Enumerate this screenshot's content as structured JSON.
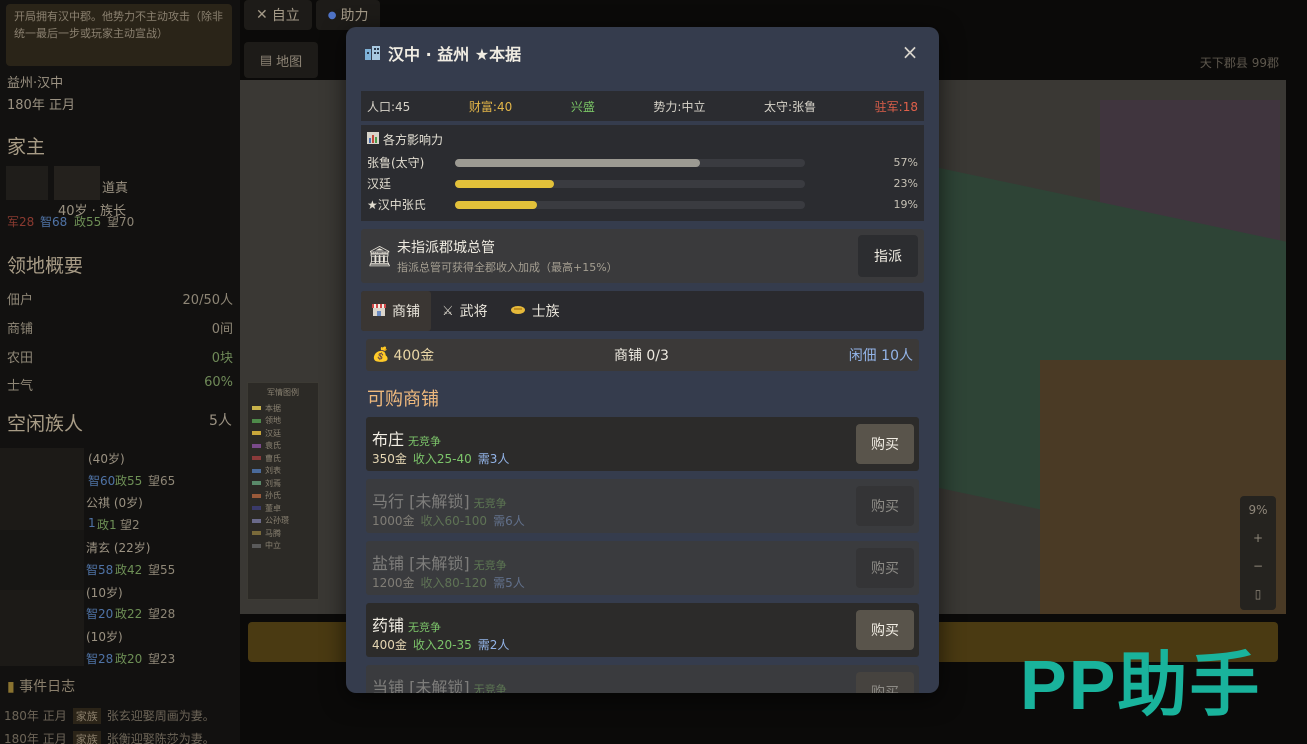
{
  "background": {
    "notice": "开局拥有汉中郡。他势力不主动攻击（除非统一最后一步或玩家主动宣战）",
    "location": "益州·汉中",
    "date": "180年 正月",
    "family_head_title": "家主",
    "head_name": "道真",
    "head_age_rank": "40岁 · 族长",
    "head_stats": {
      "mil": "军28",
      "int": "智68",
      "pol": "政55",
      "fame": "望70"
    },
    "overview_title": "领地概要",
    "overview": [
      {
        "label": "佃户",
        "value": "20/50人"
      },
      {
        "label": "商铺",
        "value": "0间"
      },
      {
        "label": "农田",
        "value": "0块"
      },
      {
        "label": "士气",
        "value": "60%"
      }
    ],
    "idle_title": "空闲族人",
    "idle_count": "5人",
    "members": [
      {
        "line1": "(40岁)",
        "line2a": "智60",
        "line2b": "政55",
        "line2c": "望65"
      },
      {
        "line1": "公祺 (0岁)",
        "line2a": "1",
        "line2b": "政1",
        "line2c": "望2"
      },
      {
        "line1": "清玄 (22岁)",
        "line2a": "智58",
        "line2b": "政42",
        "line2c": "望55"
      },
      {
        "line1": "(10岁)",
        "line2a": "智20",
        "line2b": "政22",
        "line2c": "望28"
      },
      {
        "line1": "(10岁)",
        "line2a": "智28",
        "line2b": "政20",
        "line2c": "望23"
      }
    ],
    "event_log_title": "事件日志",
    "events": [
      {
        "date": "180年 正月",
        "tag": "家族",
        "text": "张玄迎娶周画为妻。"
      },
      {
        "date": "180年 正月",
        "tag": "家族",
        "text": "张衡迎娶陈莎为妻。"
      }
    ],
    "top_tabs": [
      "自立",
      "助力"
    ],
    "map_tab": "地图",
    "top_right": "天下郡县 99郡",
    "legend_title": "军情图例",
    "legend": [
      {
        "name": "本据",
        "color": "#c8b24a"
      },
      {
        "name": "领地",
        "color": "#4e8a4a"
      },
      {
        "name": "汉廷",
        "color": "#c8a63a"
      },
      {
        "name": "袁氏",
        "color": "#7a4a8a"
      },
      {
        "name": "曹氏",
        "color": "#8a3a3a"
      },
      {
        "name": "刘表",
        "color": "#4a6a9a"
      },
      {
        "name": "刘焉",
        "color": "#5a8a6a"
      },
      {
        "name": "孙氏",
        "color": "#9a5a3a"
      },
      {
        "name": "董卓",
        "color": "#3a3a6a"
      },
      {
        "name": "公孙瓒",
        "color": "#6a6a8a"
      },
      {
        "name": "马腾",
        "color": "#7a6a3a"
      },
      {
        "name": "中立",
        "color": "#5a5a5a"
      }
    ],
    "zoom": "9%"
  },
  "modal": {
    "icon": "city-icon",
    "title": "汉中 · 益州 ★本据",
    "close": "×",
    "info": {
      "population": "人口:45",
      "wealth": "财富:40",
      "prosperity": "兴盛",
      "faction": "势力:中立",
      "governor": "太守:张鲁",
      "garrison": "驻军:18"
    },
    "influence_title": "各方影响力",
    "influence": [
      {
        "name": "张鲁(太守)",
        "percent": 57,
        "label": "57%",
        "color": "#9c9a92"
      },
      {
        "name": "汉廷",
        "percent": 23,
        "label": "23%",
        "color": "#e2c13a"
      },
      {
        "name": "★汉中张氏",
        "percent": 19,
        "label": "19%",
        "color": "#e2c13a"
      }
    ],
    "governor_panel": {
      "title": "未指派郡城总管",
      "subtitle": "指派总管可获得全郡收入加成（最高+15%）",
      "button": "指派"
    },
    "tabs": [
      {
        "label": "商铺",
        "icon": "shop-icon"
      },
      {
        "label": "武将",
        "icon": "crossed-swords-icon"
      },
      {
        "label": "士族",
        "icon": "handshake-icon"
      }
    ],
    "summary": {
      "money": "400金",
      "shops": "商铺 0/3",
      "idle": "闲佃 10人"
    },
    "section_title": "可购商铺",
    "shops": [
      {
        "name": "布庄",
        "competition": "无竞争",
        "price": "350金",
        "income": "收入25-40",
        "need": "需3人",
        "button": "购买",
        "locked": false
      },
      {
        "name": "马行 [未解锁]",
        "competition": "无竞争",
        "price": "1000金",
        "income": "收入60-100",
        "need": "需6人",
        "button": "购买",
        "locked": true
      },
      {
        "name": "盐铺 [未解锁]",
        "competition": "无竞争",
        "price": "1200金",
        "income": "收入80-120",
        "need": "需5人",
        "button": "购买",
        "locked": true
      },
      {
        "name": "药铺",
        "competition": "无竞争",
        "price": "400金",
        "income": "收入20-35",
        "need": "需2人",
        "button": "购买",
        "locked": false
      },
      {
        "name": "当铺 [未解锁]",
        "competition": "无竞争",
        "price": "",
        "income": "",
        "need": "",
        "button": "购买",
        "locked": true
      }
    ]
  },
  "watermark": "PP助手"
}
